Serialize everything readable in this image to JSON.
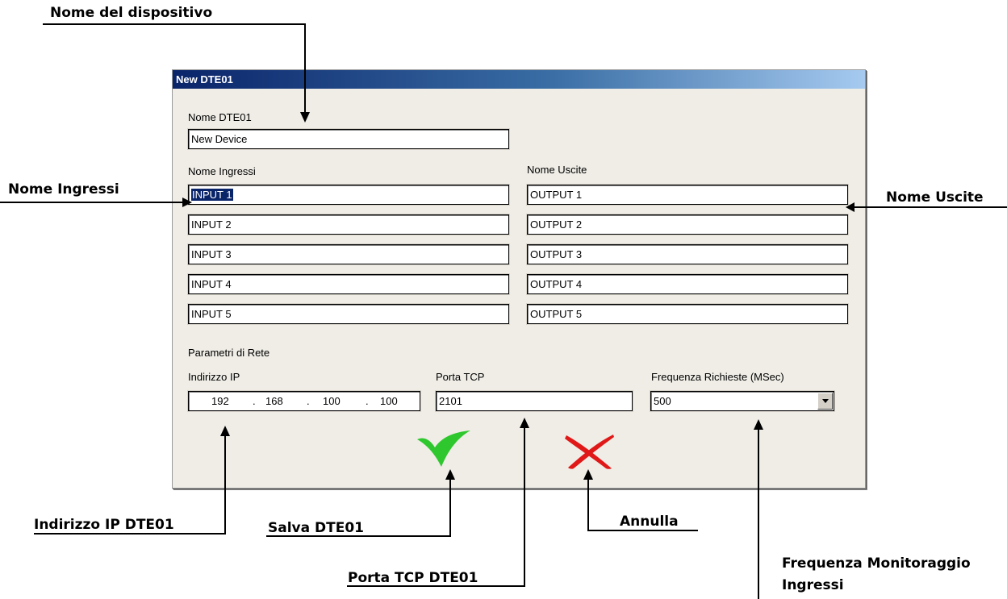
{
  "annotations": {
    "device_name": "Nome del dispositivo",
    "inputs_name": "Nome Ingressi",
    "outputs_name": "Nome Uscite",
    "ip_address": "Indirizzo IP DTE01",
    "save": "Salva DTE01",
    "cancel": "Annulla",
    "tcp_port": "Porta TCP DTE01",
    "monitor_freq_line1": "Frequenza Monitoraggio",
    "monitor_freq_line2": "Ingressi"
  },
  "window": {
    "title": "New DTE01",
    "device_name_label": "Nome DTE01",
    "device_name_value": "New Device",
    "inputs_label": "Nome Ingressi",
    "outputs_label": "Nome Uscite",
    "inputs": [
      "INPUT 1",
      "INPUT 2",
      "INPUT 3",
      "INPUT 4",
      "INPUT 5"
    ],
    "outputs": [
      "OUTPUT 1",
      "OUTPUT 2",
      "OUTPUT 3",
      "OUTPUT 4",
      "OUTPUT 5"
    ],
    "network_label": "Parametri di Rete",
    "ip_label": "Indirizzo IP",
    "ip_octets": [
      "192",
      "168",
      "100",
      "100"
    ],
    "ip_separator": ".",
    "port_label": "Porta TCP",
    "port_value": "2101",
    "freq_label": "Frequenza Richieste (MSec)",
    "freq_value": "500"
  },
  "icons": {
    "save": "green-checkmark-icon",
    "cancel": "red-x-icon",
    "dropdown": "chevron-down-icon"
  },
  "colors": {
    "save": "#2ec82e",
    "cancel": "#e01818",
    "title_start": "#0a246a",
    "title_end": "#a6caf0"
  }
}
